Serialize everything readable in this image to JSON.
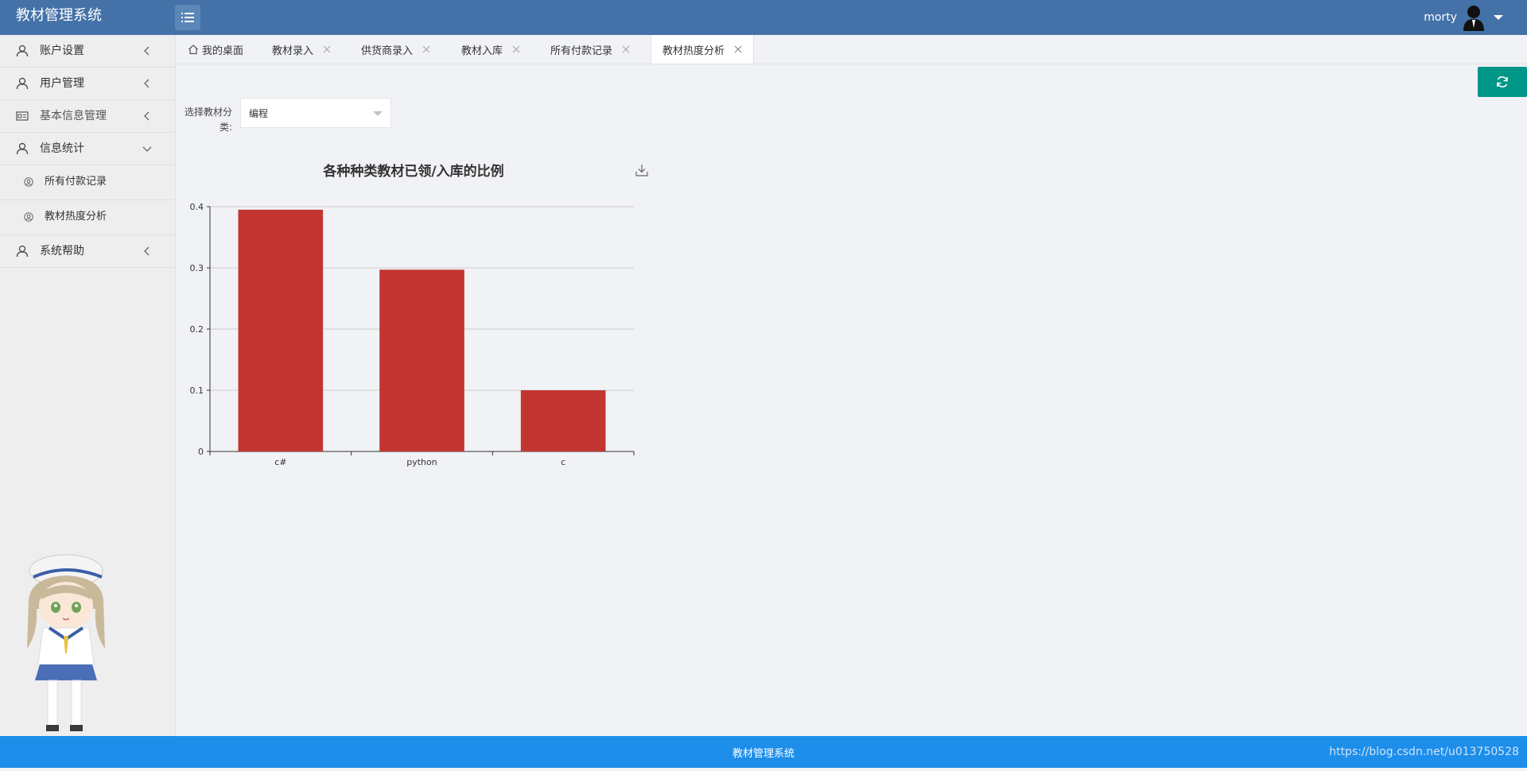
{
  "app": {
    "title": "教材管理系统",
    "user": "morty"
  },
  "sidebar": {
    "items": [
      {
        "label": "账户设置"
      },
      {
        "label": "用户管理"
      },
      {
        "label": "基本信息管理"
      },
      {
        "label": "信息统计"
      },
      {
        "label": "所有付款记录"
      },
      {
        "label": "教材热度分析"
      },
      {
        "label": "系统帮助"
      }
    ]
  },
  "tabs": [
    {
      "label": "我的桌面"
    },
    {
      "label": "教材录入"
    },
    {
      "label": "供货商录入"
    },
    {
      "label": "教材入库"
    },
    {
      "label": "所有付款记录"
    },
    {
      "label": "教材热度分析"
    }
  ],
  "filter": {
    "label": "选择教材分类:",
    "value": "编程"
  },
  "chart_data": {
    "type": "bar",
    "title": "各种种类教材已领/入库的比例",
    "categories": [
      "c#",
      "python",
      "c"
    ],
    "values": [
      0.395,
      0.297,
      0.1
    ],
    "ylim": [
      0,
      0.4
    ],
    "yticks": [
      "0",
      "0.1",
      "0.2",
      "0.3",
      "0.4"
    ],
    "grid": true,
    "color": "#c23531"
  },
  "footer": {
    "text": "教材管理系统",
    "url": "https://blog.csdn.net/u013750528"
  },
  "colors": {
    "header": "#4472a8",
    "footer": "#1e8eeb",
    "refresh": "#009688"
  }
}
